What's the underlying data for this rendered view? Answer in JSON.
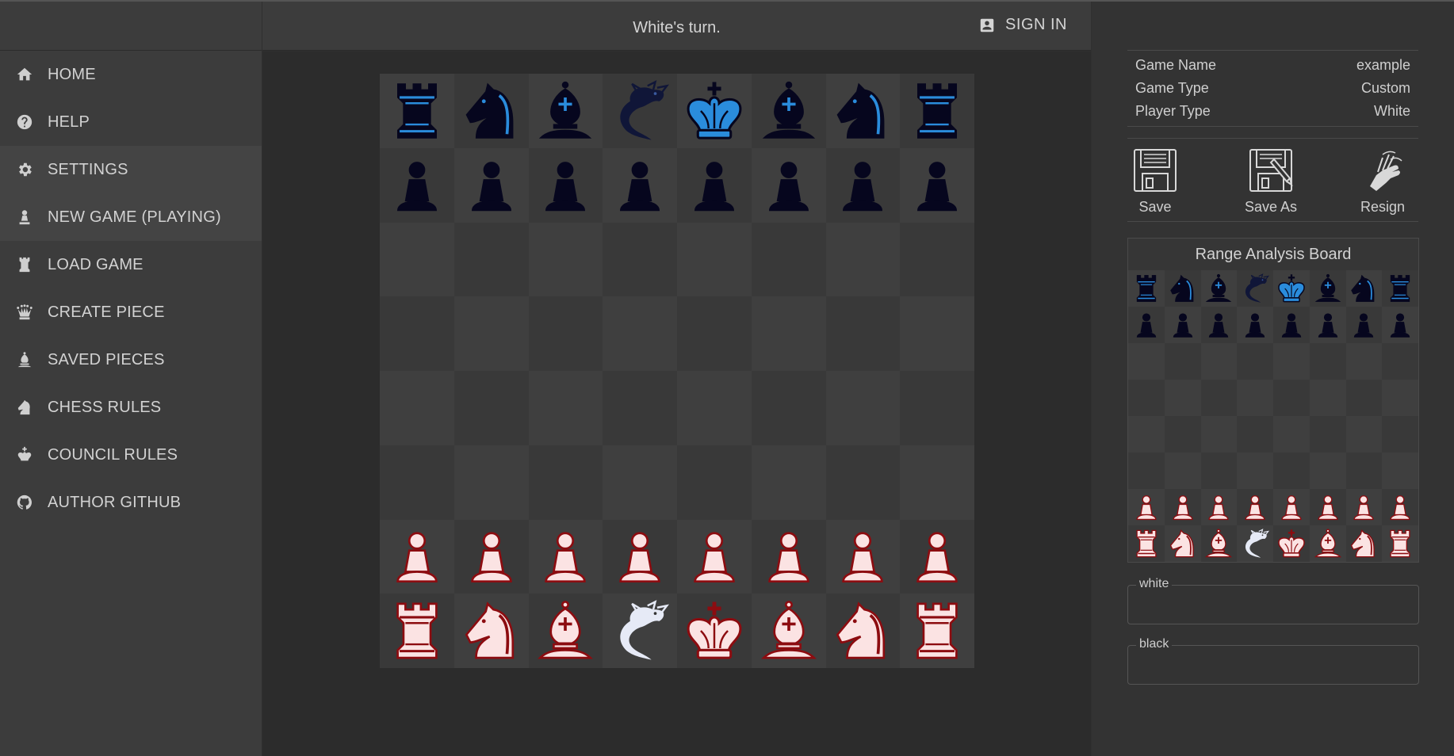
{
  "status": {
    "turn_text": "White's turn."
  },
  "header": {
    "signin_label": "SIGN IN"
  },
  "sidebar": {
    "items": [
      {
        "label": "HOME",
        "icon": "home-icon"
      },
      {
        "label": "HELP",
        "icon": "help-icon"
      },
      {
        "label": "SETTINGS",
        "icon": "gear-icon"
      },
      {
        "label": "NEW GAME (PLAYING)",
        "icon": "pawn-icon"
      },
      {
        "label": "LOAD GAME",
        "icon": "rook-icon"
      },
      {
        "label": "CREATE PIECE",
        "icon": "queen-icon"
      },
      {
        "label": "SAVED PIECES",
        "icon": "bishop-icon"
      },
      {
        "label": "CHESS RULES",
        "icon": "knight-icon"
      },
      {
        "label": "COUNCIL RULES",
        "icon": "king-icon"
      },
      {
        "label": "AUTHOR GITHUB",
        "icon": "github-icon"
      }
    ]
  },
  "game_info": [
    {
      "label": "Game Name",
      "value": "example"
    },
    {
      "label": "Game Type",
      "value": "Custom"
    },
    {
      "label": "Player Type",
      "value": "White"
    }
  ],
  "actions": {
    "save_label": "Save",
    "save_as_label": "Save As",
    "resign_label": "Resign"
  },
  "range_board": {
    "title": "Range Analysis Board"
  },
  "fields": {
    "white_label": "white",
    "black_label": "black"
  },
  "colors": {
    "black_piece_fill": "#06061e",
    "black_piece_accent": "#2a8cdc",
    "white_piece_fill": "#fbe3e3",
    "white_piece_outline": "#8c0c10",
    "light_square": "#3f3f3f",
    "dark_square": "#393939"
  },
  "board": {
    "rows": [
      [
        "bR",
        "bN",
        "bB",
        "bD",
        "bK",
        "bB",
        "bN",
        "bR"
      ],
      [
        "bP",
        "bP",
        "bP",
        "bP",
        "bP",
        "bP",
        "bP",
        "bP"
      ],
      [
        "",
        "",
        "",
        "",
        "",
        "",
        "",
        ""
      ],
      [
        "",
        "",
        "",
        "",
        "",
        "",
        "",
        ""
      ],
      [
        "",
        "",
        "",
        "",
        "",
        "",
        "",
        ""
      ],
      [
        "",
        "",
        "",
        "",
        "",
        "",
        "",
        ""
      ],
      [
        "wP",
        "wP",
        "wP",
        "wP",
        "wP",
        "wP",
        "wP",
        "wP"
      ],
      [
        "wR",
        "wN",
        "wB",
        "wD",
        "wK",
        "wB",
        "wN",
        "wR"
      ]
    ]
  }
}
